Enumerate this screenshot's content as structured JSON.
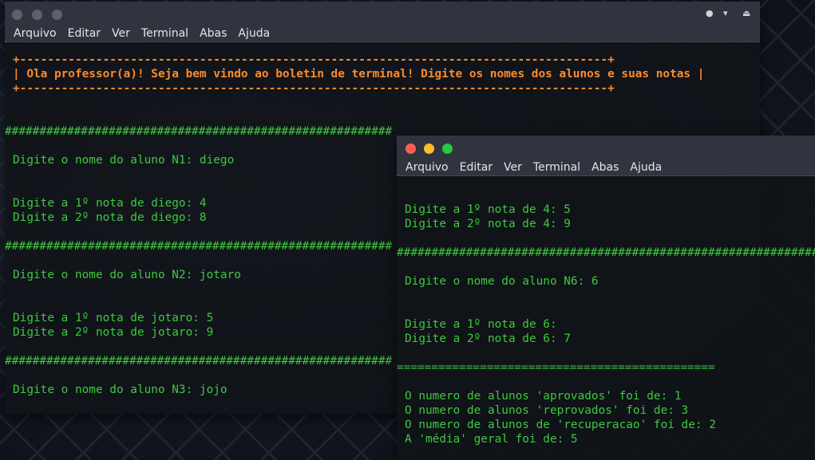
{
  "menu": [
    "Arquivo",
    "Editar",
    "Ver",
    "Terminal",
    "Abas",
    "Ajuda"
  ],
  "colors": {
    "terminal_green": "#3ec93e",
    "banner_orange": "#ff8a2b",
    "close": "#ff5f57",
    "minimize": "#febc2e",
    "maximize": "#28c840"
  },
  "window1": {
    "banner": [
      "+-------------------------------------------------------------------------------------+",
      "| Ola professor(a)! Seja bem vindo ao boletin de terminal! Digite os nomes dos alunos e suas notas |",
      "+-------------------------------------------------------------------------------------+"
    ],
    "lines": [
      "########################################################",
      "Digite o nome do aluno N1: diego",
      "Digite a 1º nota de diego: 4",
      "Digite a 2º nota de diego: 8",
      "########################################################",
      "Digite o nome do aluno N2: jotaro",
      "Digite a 1º nota de jotaro: 5",
      "Digite a 2º nota de jotaro: 9",
      "########################################################",
      "Digite o nome do aluno N3: jojo"
    ]
  },
  "window2": {
    "lines": [
      "Digite a 1º nota de 4: 5",
      "Digite a 2º nota de 4: 9",
      "#######################################################################",
      "Digite o nome do aluno N6: 6",
      "Digite a 1º nota de 6:",
      "Digite a 2º nota de 6: 7",
      "==============================================",
      "O numero de alunos 'aprovados' foi de: 1",
      "O numero de alunos 'reprovados' foi de: 3",
      "O numero de alunos de 'recuperacao' foi de: 2",
      "A 'média' geral foi de: 5"
    ]
  }
}
